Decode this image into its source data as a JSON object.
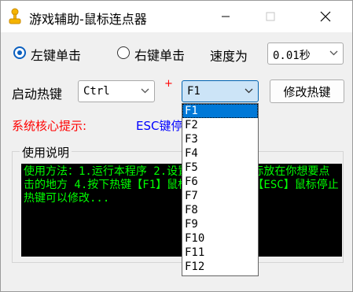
{
  "window": {
    "title": "游戏辅助-鼠标连点器",
    "icon": "joystick-icon",
    "minimize_icon": "minimize-icon",
    "maximize_icon": "maximize-icon",
    "close_icon": "close-icon"
  },
  "click_mode": {
    "left_label": "左键单击",
    "right_label": "右键单击",
    "selected": "左键单击"
  },
  "speed": {
    "label": "速度为",
    "value": "0.01秒"
  },
  "hotkey": {
    "label": "启动热键",
    "modifier": "Ctrl",
    "plus": "+",
    "key": "F1",
    "modify_button": "修改热键",
    "options": [
      "F1",
      "F2",
      "F3",
      "F4",
      "F5",
      "F6",
      "F7",
      "F8",
      "F9",
      "F10",
      "F11",
      "F12"
    ],
    "selected_index": 0
  },
  "hint": {
    "label": "系统核心提示:",
    "text": "ESC键停"
  },
  "instructions": {
    "title": "使用说明",
    "text": "使用方法：1.运行本程序 2.设置热键 3.把鼠标放在你想要点击的地方 4.按下热键【F1】鼠标自动点击 5.【ESC】鼠标停止 热键可以修改..."
  },
  "colors": {
    "accent": "#0078d7",
    "hint_label": "#ff0000",
    "hint_text": "#0000ff",
    "console_bg": "#000000",
    "console_text": "#00ff00"
  }
}
